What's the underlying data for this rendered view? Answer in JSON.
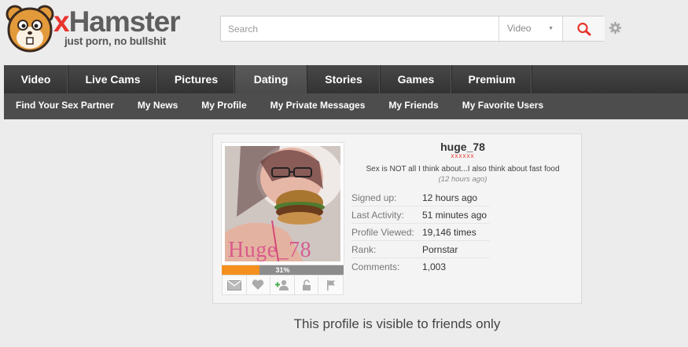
{
  "header": {
    "logo_x": "x",
    "logo_word": "Hamster",
    "logo_tagline": "just porn, no bullshit",
    "search": {
      "placeholder": "Search",
      "value": "",
      "type_selected": "Video"
    }
  },
  "nav": {
    "tabs": [
      {
        "label": "Video"
      },
      {
        "label": "Live Cams"
      },
      {
        "label": "Pictures"
      },
      {
        "label": "Dating",
        "active": true
      },
      {
        "label": "Stories"
      },
      {
        "label": "Games"
      },
      {
        "label": "Premium"
      }
    ],
    "sub": [
      {
        "label": "Find Your Sex Partner"
      },
      {
        "label": "My News"
      },
      {
        "label": "My Profile"
      },
      {
        "label": "My Private Messages"
      },
      {
        "label": "My Friends"
      },
      {
        "label": "My Favorite Users"
      }
    ]
  },
  "profile": {
    "username": "huge_78",
    "stars": "xxxxxx",
    "status": "Sex is NOT all I think about...I also think about fast food",
    "status_time": "(12 hours ago)",
    "photo_watermark": "Huge_78",
    "completion": 0.31,
    "completion_label": "31%",
    "actions": [
      "mail-icon",
      "heart-icon",
      "add-friend-icon",
      "lock-icon",
      "flag-icon"
    ],
    "stats": [
      {
        "key": "Signed up:",
        "value": "12 hours ago"
      },
      {
        "key": "Last Activity:",
        "value": "51 minutes ago"
      },
      {
        "key": "Profile Viewed:",
        "value": "19,146 times"
      },
      {
        "key": "Rank:",
        "value": "Pornstar"
      },
      {
        "key": "Comments:",
        "value": "1,003"
      }
    ]
  },
  "notice": "This profile is visible to friends only",
  "colors": {
    "brand_red": "#e8352d",
    "progress_orange": "#f5901e",
    "nav_dark": "#3a3a3a"
  }
}
